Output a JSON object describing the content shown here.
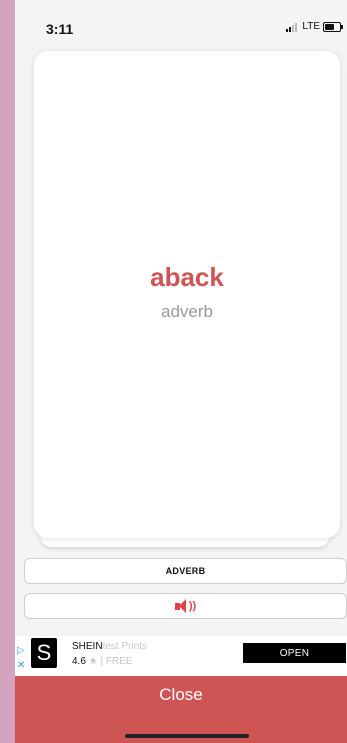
{
  "status_bar": {
    "time": "3:11",
    "network": "LTE"
  },
  "card": {
    "word": "aback",
    "part_of_speech": "adverb"
  },
  "buttons": {
    "part_of_speech_label": "ADVERB"
  },
  "icons": {
    "speaker": "speaker-icon",
    "shein_logo": "S",
    "star": "★"
  },
  "ad": {
    "badge": "▷",
    "close": "✕",
    "brand": "SHEIN",
    "tagline_faded": "test Prints",
    "rating": "4.6",
    "price_faded": "| FREE",
    "open_label": "OPEN"
  },
  "footer": {
    "close_label": "Close"
  },
  "colors": {
    "accent": "#cf5555",
    "background": "#f4f4f4",
    "side_backdrop": "#d4a3bf"
  }
}
